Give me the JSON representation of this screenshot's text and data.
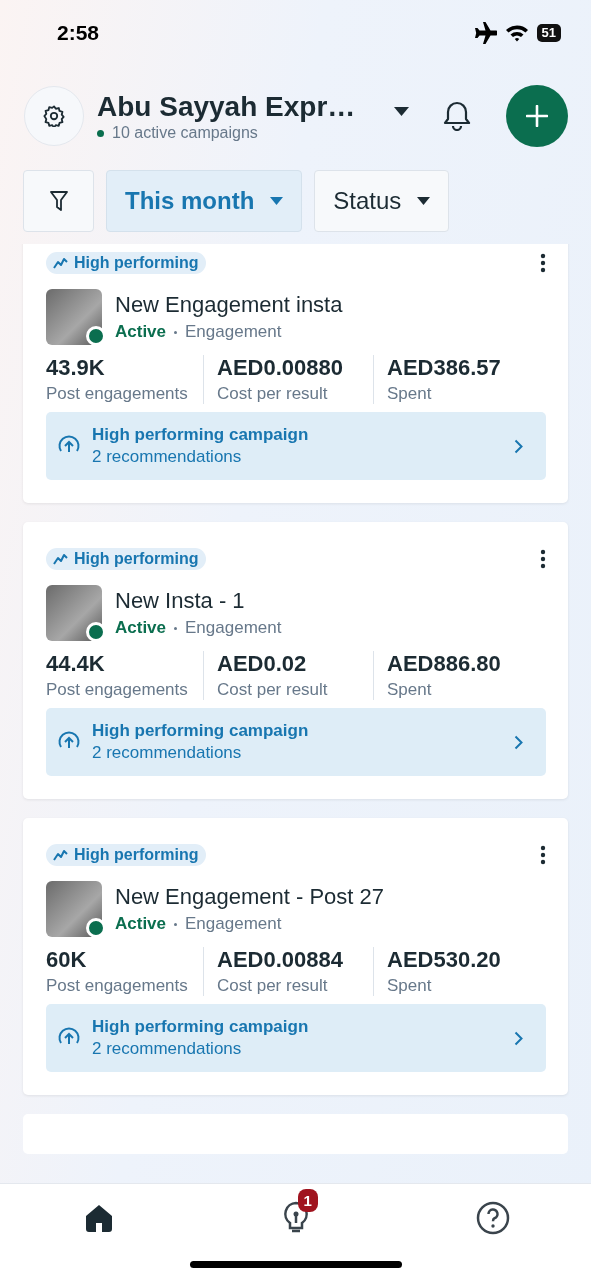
{
  "status_bar": {
    "time": "2:58",
    "battery": "51"
  },
  "header": {
    "title": "Abu Sayyah Expr…",
    "subtitle": "10 active campaigns"
  },
  "filters": [
    {
      "label": "This month",
      "selected": true
    },
    {
      "label": "Status",
      "selected": false
    }
  ],
  "campaigns": [
    {
      "badge": "High performing",
      "name": "New Engagement insta",
      "status": "Active",
      "objective": "Engagement",
      "metrics": [
        {
          "value": "43.9K",
          "label": "Post engagements"
        },
        {
          "value": "AED0.00880",
          "label": "Cost per result"
        },
        {
          "value": "AED386.57",
          "label": "Spent"
        }
      ],
      "recommendation": {
        "title": "High performing campaign",
        "subtitle": "2 recommendations"
      }
    },
    {
      "badge": "High performing",
      "name": "New Insta - 1",
      "status": "Active",
      "objective": "Engagement",
      "metrics": [
        {
          "value": "44.4K",
          "label": "Post engagements"
        },
        {
          "value": "AED0.02",
          "label": "Cost per result"
        },
        {
          "value": "AED886.80",
          "label": "Spent"
        }
      ],
      "recommendation": {
        "title": "High performing campaign",
        "subtitle": "2 recommendations"
      }
    },
    {
      "badge": "High performing",
      "name": "New Engagement - Post 27",
      "status": "Active",
      "objective": "Engagement",
      "metrics": [
        {
          "value": "60K",
          "label": "Post engagements"
        },
        {
          "value": "AED0.00884",
          "label": "Cost per result"
        },
        {
          "value": "AED530.20",
          "label": "Spent"
        }
      ],
      "recommendation": {
        "title": "High performing campaign",
        "subtitle": "2 recommendations"
      }
    }
  ],
  "nav": [
    {
      "kind": "home",
      "selected": true
    },
    {
      "kind": "ideas",
      "selected": false,
      "badge": "1"
    },
    {
      "kind": "help",
      "selected": false
    }
  ]
}
